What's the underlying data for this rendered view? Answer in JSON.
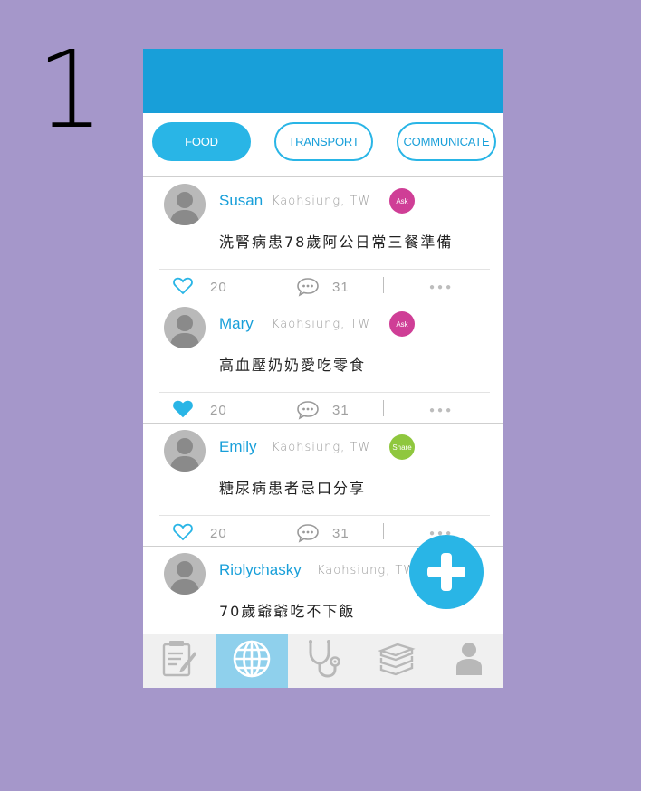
{
  "step_number": "1",
  "tabs": [
    {
      "label": "FOOD",
      "active": true
    },
    {
      "label": "TRANSPORT",
      "active": false
    },
    {
      "label": "COMMUNICATE",
      "active": false
    }
  ],
  "posts": [
    {
      "name": "Susan",
      "location": "Kaohsiung, TW",
      "badge": "Ask",
      "text": "洗腎病患78歲阿公日常三餐準備",
      "likes": "20",
      "comments": "31",
      "liked": false
    },
    {
      "name": "Mary",
      "location": "Kaohsiung, TW",
      "badge": "Ask",
      "text": "高血壓奶奶愛吃零食",
      "likes": "20",
      "comments": "31",
      "liked": true
    },
    {
      "name": "Emily",
      "location": "Kaohsiung, TW",
      "badge": "Share",
      "text": "糖尿病患者忌口分享",
      "likes": "20",
      "comments": "31",
      "liked": false
    },
    {
      "name": "Riolychasky",
      "location": "Kaohsiung, TW",
      "text": "70歲爺爺吃不下飯"
    }
  ],
  "bottom_nav": [
    {
      "icon": "notepad-icon",
      "active": false
    },
    {
      "icon": "globe-icon",
      "active": true
    },
    {
      "icon": "stethoscope-icon",
      "active": false
    },
    {
      "icon": "books-icon",
      "active": false
    },
    {
      "icon": "person-icon",
      "active": false
    }
  ],
  "colors": {
    "background": "#a597ca",
    "primary_blue": "#189fd9",
    "accent_blue": "#29b5e6",
    "ask_badge": "#cf3e96",
    "share_badge": "#8fc73e"
  }
}
